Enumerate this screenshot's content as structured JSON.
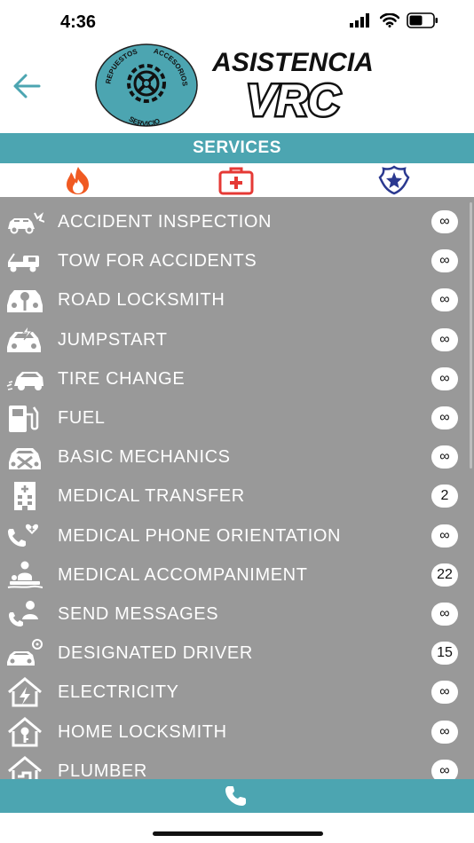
{
  "status": {
    "time": "4:36"
  },
  "header": {
    "badge_top": "REPUESTOS",
    "badge_right": "ACCESORIOS",
    "badge_bottom": "SERVICIO",
    "wordmark_top": "ASISTENCIA",
    "wordmark_bottom": "VRC"
  },
  "services_bar": {
    "title": "SERVICES"
  },
  "categories": [
    {
      "icon": "fire-icon",
      "color": "#f05a22"
    },
    {
      "icon": "first-aid-kit-icon",
      "color": "#e53935"
    },
    {
      "icon": "police-badge-icon",
      "color": "#2b3990"
    }
  ],
  "services": [
    {
      "label": "ACCIDENT INSPECTION",
      "badge": "∞",
      "icon": "car-crash-icon"
    },
    {
      "label": "TOW FOR ACCIDENTS",
      "badge": "∞",
      "icon": "tow-truck-icon"
    },
    {
      "label": "ROAD LOCKSMITH",
      "badge": "∞",
      "icon": "car-key-icon"
    },
    {
      "label": "JUMPSTART",
      "badge": "∞",
      "icon": "car-battery-icon"
    },
    {
      "label": "TIRE CHANGE",
      "badge": "∞",
      "icon": "car-tire-icon"
    },
    {
      "label": "FUEL",
      "badge": "∞",
      "icon": "fuel-pump-icon"
    },
    {
      "label": "BASIC MECHANICS",
      "badge": "∞",
      "icon": "car-wrench-icon"
    },
    {
      "label": "MEDICAL TRANSFER",
      "badge": "2",
      "icon": "hospital-building-icon"
    },
    {
      "label": "MEDICAL PHONE ORIENTATION",
      "badge": "∞",
      "icon": "medical-phone-icon"
    },
    {
      "label": "MEDICAL ACCOMPANIMENT",
      "badge": "22",
      "icon": "patient-care-icon"
    },
    {
      "label": "SEND MESSAGES",
      "badge": "∞",
      "icon": "person-phone-icon"
    },
    {
      "label": "DESIGNATED DRIVER",
      "badge": "15",
      "icon": "driver-car-icon"
    },
    {
      "label": "ELECTRICITY",
      "badge": "∞",
      "icon": "house-electricity-icon"
    },
    {
      "label": "HOME LOCKSMITH",
      "badge": "∞",
      "icon": "house-key-icon"
    },
    {
      "label": "PLUMBER",
      "badge": "∞",
      "icon": "house-plumbing-icon"
    }
  ],
  "colors": {
    "teal": "#4ca5b1",
    "list_bg": "#999999"
  }
}
